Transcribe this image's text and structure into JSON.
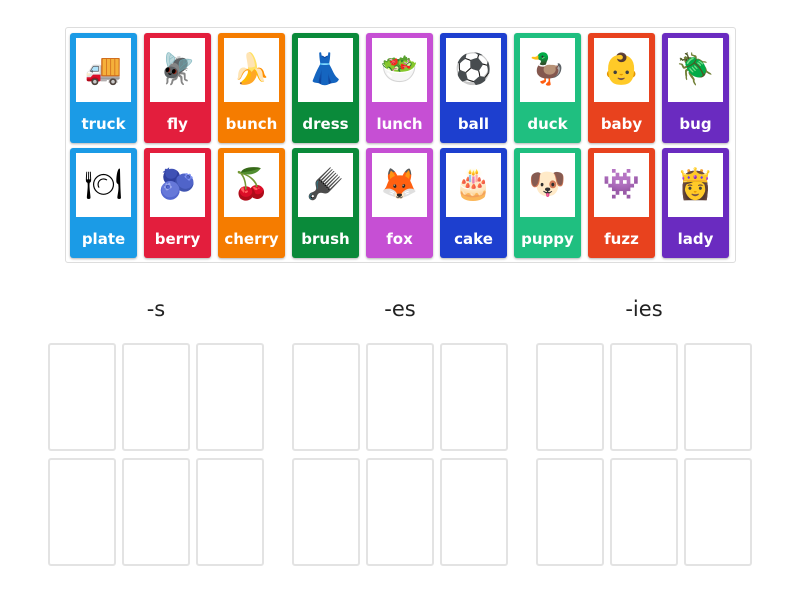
{
  "cards": [
    {
      "label": "truck",
      "color": "#1b9be6",
      "icon": "truck-icon",
      "glyph": "🚚"
    },
    {
      "label": "fly",
      "color": "#e31e3d",
      "icon": "fly-icon",
      "glyph": "🪰"
    },
    {
      "label": "bunch",
      "color": "#f57c00",
      "icon": "bananas-icon",
      "glyph": "🍌"
    },
    {
      "label": "dress",
      "color": "#0a8a3a",
      "icon": "dress-icon",
      "glyph": "👗"
    },
    {
      "label": "lunch",
      "color": "#c64fd4",
      "icon": "lunch-icon",
      "glyph": "🥗"
    },
    {
      "label": "ball",
      "color": "#1d3fcf",
      "icon": "ball-icon",
      "glyph": "⚽"
    },
    {
      "label": "duck",
      "color": "#1fbf80",
      "icon": "duck-icon",
      "glyph": "🦆"
    },
    {
      "label": "baby",
      "color": "#e8421e",
      "icon": "baby-icon",
      "glyph": "👶"
    },
    {
      "label": "bug",
      "color": "#6a2bc0",
      "icon": "bug-icon",
      "glyph": "🪲"
    },
    {
      "label": "plate",
      "color": "#1b9be6",
      "icon": "plate-icon",
      "glyph": "🍽"
    },
    {
      "label": "berry",
      "color": "#e31e3d",
      "icon": "berry-icon",
      "glyph": "🫐"
    },
    {
      "label": "cherry",
      "color": "#f57c00",
      "icon": "cherry-icon",
      "glyph": "🍒"
    },
    {
      "label": "brush",
      "color": "#0a8a3a",
      "icon": "brush-icon",
      "glyph": "🪮"
    },
    {
      "label": "fox",
      "color": "#c64fd4",
      "icon": "fox-icon",
      "glyph": "🦊"
    },
    {
      "label": "cake",
      "color": "#1d3fcf",
      "icon": "cake-icon",
      "glyph": "🎂"
    },
    {
      "label": "puppy",
      "color": "#1fbf80",
      "icon": "puppy-icon",
      "glyph": "🐶"
    },
    {
      "label": "fuzz",
      "color": "#e8421e",
      "icon": "fuzzball-icon",
      "glyph": "👾"
    },
    {
      "label": "lady",
      "color": "#6a2bc0",
      "icon": "lady-icon",
      "glyph": "👸"
    }
  ],
  "groups": [
    {
      "label": "-s"
    },
    {
      "label": "-es"
    },
    {
      "label": "-ies"
    }
  ]
}
